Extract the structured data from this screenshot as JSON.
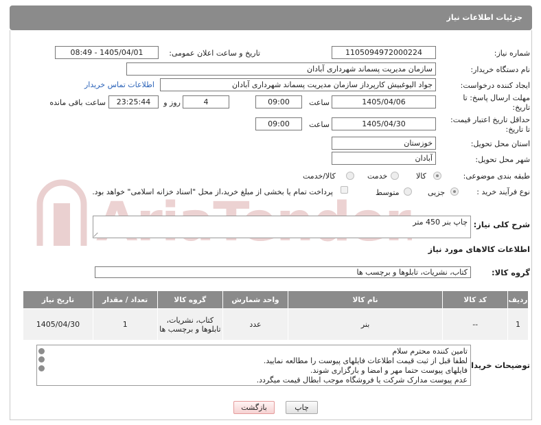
{
  "header": {
    "title": "جزئیات اطلاعات نیاز"
  },
  "form": {
    "need_number": {
      "label": "شماره نیاز:",
      "value": "1105094972000224"
    },
    "announce": {
      "label": "تاریخ و ساعت اعلان عمومی:",
      "value": "1405/04/01 - 08:49"
    },
    "buyer_org": {
      "label": "نام دستگاه خریدار:",
      "value": "سازمان مدیریت پسماند شهرداری آبادان"
    },
    "requester": {
      "label": "ایجاد کننده درخواست:",
      "value": "جواد الیوغبیش کارپرداز سازمان مدیریت پسماند شهرداری آبادان",
      "contact_link": "اطلاعات تماس خریدار"
    },
    "reply_deadline": {
      "label_line1": "مهلت ارسال پاسخ: تا",
      "label_line2": "تاریخ:",
      "date": "1405/04/06",
      "time_label": "ساعت",
      "time": "09:00",
      "days": "4",
      "days_label": "روز و",
      "remaining": "23:25:44",
      "remaining_label": "ساعت باقی مانده"
    },
    "price_deadline": {
      "label_line1": "حداقل تاریخ اعتبار قیمت:",
      "label_line2": "تا تاریخ:",
      "date": "1405/04/30",
      "time_label": "ساعت",
      "time": "09:00"
    },
    "delivery_province": {
      "label": "استان محل تحویل:",
      "value": "خوزستان"
    },
    "delivery_city": {
      "label": "شهر محل تحویل:",
      "value": "آبادان"
    },
    "category": {
      "label": "طبقه بندی موضوعی:",
      "options": [
        "کالا",
        "خدمت",
        "کالا/خدمت"
      ],
      "selected": "کالا"
    },
    "process": {
      "label": "نوع فرآیند خرید :",
      "options": [
        "جزیی",
        "متوسط"
      ],
      "selected": "جزیی",
      "payment_note": "پرداخت تمام یا بخشی از مبلغ خرید،از محل \"اسناد خزانه اسلامی\" خواهد بود."
    }
  },
  "description": {
    "label": "شرح کلی نیاز:",
    "value": "چاپ بنر 450 متر"
  },
  "goods": {
    "title": "اطلاعات کالاهای مورد نیاز",
    "group_label": "گروه کالا:",
    "group_value": "کتاب، نشریات، تابلوها و برچسب ها",
    "columns": [
      "ردیف",
      "کد کالا",
      "نام کالا",
      "واحد شمارش",
      "گروه کالا",
      "تعداد / مقدار",
      "تاریخ نیاز"
    ],
    "rows": [
      {
        "index": "1",
        "code": "--",
        "name": "بنر",
        "unit": "عدد",
        "group": "کتاب، نشریات، تابلوها و برچسب ها",
        "qty": "1",
        "date": "1405/04/30"
      }
    ]
  },
  "buyer_notes": {
    "label": "توضیحات خریدار:",
    "lines": [
      "تامین کننده محترم سلام",
      "لطفا قبل از ثبت قیمت اطلاعات فایلهای پیوست را مطالعه نمایید.",
      "فایلهای پیوست حتما مهر و امضا و بارگزاری شوند.",
      "عدم پیوست مدارک شرکت یا فروشگاه موجب ابطال قیمت میگردد."
    ]
  },
  "buttons": {
    "print": "چاپ",
    "back": "بازگشت"
  },
  "watermark": {
    "text": "AriaTender.neT",
    "color": "#e8b3b3"
  }
}
